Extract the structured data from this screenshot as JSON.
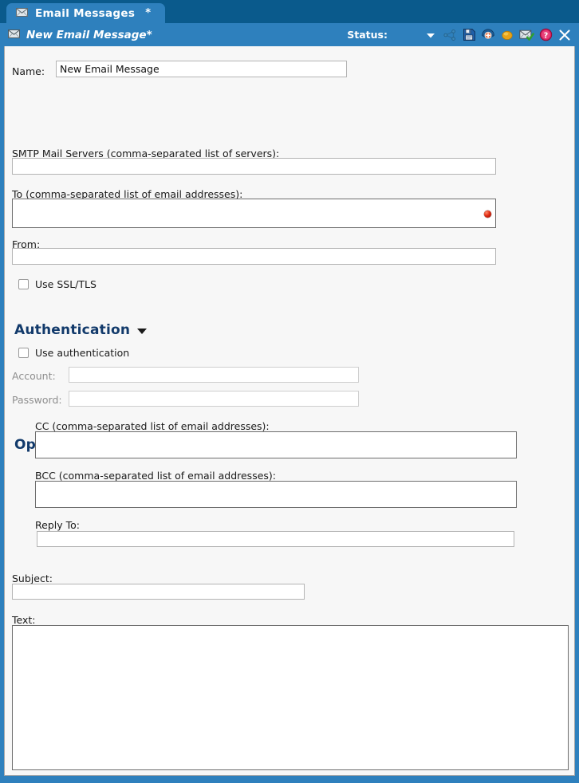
{
  "window": {
    "tab": {
      "label": "Email Messages",
      "modified_marker": "*",
      "icon": "envelope-icon"
    },
    "header": {
      "title": "New Email Message*",
      "icon": "envelope-icon",
      "status_label": "Status:",
      "icons": [
        {
          "name": "status-dropdown-caret-icon"
        },
        {
          "name": "share-graph-icon"
        },
        {
          "name": "save-floppy-icon"
        },
        {
          "name": "deploy-parachute-icon"
        },
        {
          "name": "orange-status-dot-icon"
        },
        {
          "name": "send-mail-check-icon"
        },
        {
          "name": "help-question-icon"
        },
        {
          "name": "close-x-icon"
        }
      ]
    },
    "colors": {
      "frame_dark_blue": "#0a5a8c",
      "frame_blue": "#2e80bd",
      "panel_bg": "#f7f7f7",
      "heading_blue": "#123a6b",
      "required_red": "#e02b12"
    }
  },
  "form": {
    "name": {
      "label": "Name:",
      "value": "New Email Message",
      "placeholder": ""
    },
    "smtp": {
      "label": "SMTP Mail Servers (comma-separated list of servers):",
      "value": "",
      "placeholder": ""
    },
    "to": {
      "label": "To (comma-separated list of email addresses):",
      "value": "",
      "placeholder": "",
      "required": true
    },
    "from": {
      "label": "From:",
      "value": "",
      "placeholder": ""
    },
    "ssl": {
      "label": "Use SSL/TLS",
      "checked": false
    },
    "authentication": {
      "title": "Authentication",
      "expanded": true,
      "use_auth": {
        "label": "Use authentication",
        "checked": false
      },
      "account": {
        "label": "Account:",
        "value": "",
        "placeholder": "",
        "disabled": true
      },
      "password": {
        "label": "Password:",
        "value": "",
        "placeholder": "",
        "disabled": true
      }
    },
    "optional": {
      "title": "Optional",
      "expanded": true,
      "cc": {
        "label": "CC (comma-separated list of email addresses):",
        "value": "",
        "placeholder": ""
      },
      "bcc": {
        "label": "BCC (comma-separated list of email addresses):",
        "value": "",
        "placeholder": ""
      },
      "reply_to": {
        "label": "Reply To:",
        "value": "",
        "placeholder": ""
      }
    },
    "subject": {
      "label": "Subject:",
      "value": "",
      "placeholder": ""
    },
    "text": {
      "label": "Text:",
      "value": "",
      "placeholder": ""
    }
  }
}
